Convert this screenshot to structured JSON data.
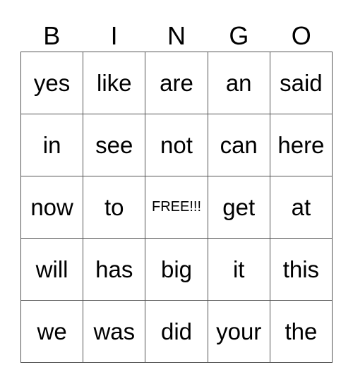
{
  "card": {
    "header": [
      "B",
      "I",
      "N",
      "G",
      "O"
    ],
    "rows": [
      [
        "yes",
        "like",
        "are",
        "an",
        "said"
      ],
      [
        "in",
        "see",
        "not",
        "can",
        "here"
      ],
      [
        "now",
        "to",
        "FREE!!!",
        "get",
        "at"
      ],
      [
        "will",
        "has",
        "big",
        "it",
        "this"
      ],
      [
        "we",
        "was",
        "did",
        "your",
        "the"
      ]
    ],
    "free_space_label": "FREE!!!"
  }
}
